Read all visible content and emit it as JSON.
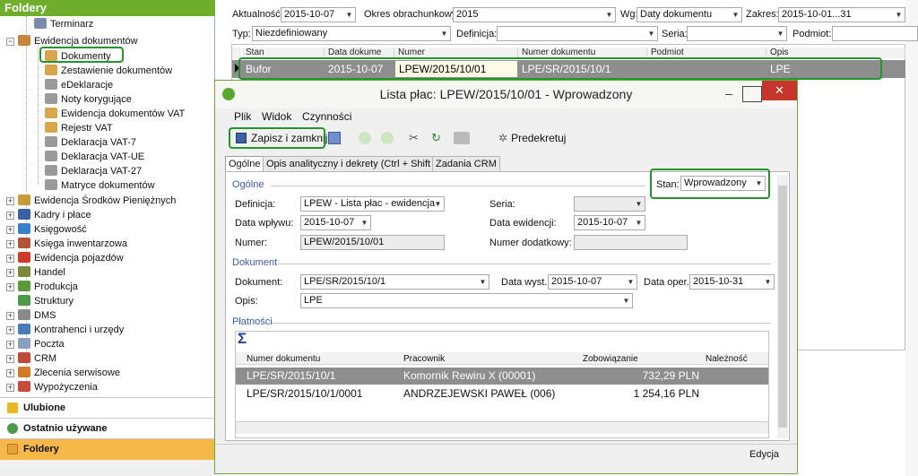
{
  "left_panel": {
    "title": "Foldery",
    "items": [
      {
        "label": "Terminarz",
        "color": "#7a8ca8"
      },
      {
        "label": "Ewidencja dokumentów",
        "color": "#c8843a"
      },
      {
        "label": "Dokumenty",
        "color": "#d9a650"
      },
      {
        "label": "Zestawienie dokumentów",
        "color": "#d9a650"
      },
      {
        "label": "eDeklaracje",
        "color": "#9a9a9a"
      },
      {
        "label": "Noty korygujące",
        "color": "#9a9a9a"
      },
      {
        "label": "Ewidencja dokumentów VAT",
        "color": "#d9a650"
      },
      {
        "label": "Rejestr VAT",
        "color": "#d9a650"
      },
      {
        "label": "Deklaracja VAT-7",
        "color": "#9a9a9a"
      },
      {
        "label": "Deklaracja VAT-UE",
        "color": "#9a9a9a"
      },
      {
        "label": "Deklaracja VAT-27",
        "color": "#9a9a9a"
      },
      {
        "label": "Matryce dokumentów",
        "color": "#9a9a9a"
      },
      {
        "label": "Ewidencja Środków Pieniężnych",
        "color": "#c99a3a"
      },
      {
        "label": "Kadry i płace",
        "color": "#3a5fa8"
      },
      {
        "label": "Księgowość",
        "color": "#3a80c8"
      },
      {
        "label": "Księga inwentarzowa",
        "color": "#b0543a"
      },
      {
        "label": "Ewidencja pojazdów",
        "color": "#d03a2a"
      },
      {
        "label": "Handel",
        "color": "#7a8a3a"
      },
      {
        "label": "Produkcja",
        "color": "#5a9a3a"
      },
      {
        "label": "Struktury",
        "color": "#4a9a4a"
      },
      {
        "label": "DMS",
        "color": "#8a8a8a"
      },
      {
        "label": "Kontrahenci i urzędy",
        "color": "#4a7ab8"
      },
      {
        "label": "Poczta",
        "color": "#8aa0c0"
      },
      {
        "label": "CRM",
        "color": "#c04a3a"
      },
      {
        "label": "Zlecenia serwisowe",
        "color": "#d07a2a"
      },
      {
        "label": "Wypożyczenia",
        "color": "#c84a3a"
      }
    ],
    "bottom": [
      {
        "label": "Ulubione",
        "color": "#e8b820"
      },
      {
        "label": "Ostatnio używane",
        "color": "#4a9a4a"
      },
      {
        "label": "Foldery",
        "color": "#d9a650"
      }
    ]
  },
  "filters": {
    "aktualnosc_label": "Aktualność:",
    "aktualnosc_value": "2015-10-07",
    "okres_label": "Okres obrachunkowy:",
    "okres_value": "2015",
    "wg_label": "Wg:",
    "wg_value": "Daty dokumentu",
    "zakres_label": "Zakres:",
    "zakres_value": "2015-10-01...31",
    "typ_label": "Typ:",
    "typ_value": "Niezdefiniowany",
    "definicja_label": "Definicja:",
    "definicja_value": "",
    "seria_label": "Seria:",
    "seria_value": "",
    "podmiot_label": "Podmiot:",
    "podmiot_value": ""
  },
  "grid": {
    "headers": [
      "Stan",
      "Data dokume",
      "Numer",
      "Numer dokumentu",
      "Podmiot",
      "Opis"
    ],
    "row": {
      "stan": "Bufor",
      "data": "2015-10-07",
      "numer": "LPEW/2015/10/01",
      "numer_dok": "LPE/SR/2015/10/1",
      "podmiot": "",
      "opis": "LPE"
    }
  },
  "dialog": {
    "title": "Lista płac: LPEW/2015/10/01 - Wprowadzony",
    "menu": [
      "Plik",
      "Widok",
      "Czynności"
    ],
    "toolbar": {
      "save_close": "Zapisz i zamknij",
      "predekretuj": "Predekretuj"
    },
    "tabs": [
      "Ogólne",
      "Opis analityczny i dekrety (Ctrl + Shift + D)",
      "Zadania CRM"
    ],
    "stan_label": "Stan:",
    "stan_value": "Wprowadzony",
    "ogolne": {
      "section": "Ogólne",
      "definicja_label": "Definicja:",
      "definicja_value": "LPEW - Lista płac - ewidencja",
      "seria_label": "Seria:",
      "seria_value": "",
      "data_wplywu_label": "Data wpływu:",
      "data_wplywu_value": "2015-10-07",
      "data_ewidencji_label": "Data ewidencji:",
      "data_ewidencji_value": "2015-10-07",
      "numer_label": "Numer:",
      "numer_value": "LPEW/2015/10/01",
      "numer_dod_label": "Numer dodatkowy:",
      "numer_dod_value": ""
    },
    "dokument": {
      "section": "Dokument",
      "dokument_label": "Dokument:",
      "dokument_value": "LPE/SR/2015/10/1",
      "data_wyst_label": "Data wyst.:",
      "data_wyst_value": "2015-10-07",
      "data_oper_label": "Data oper.:",
      "data_oper_value": "2015-10-31",
      "opis_label": "Opis:",
      "opis_value": "LPE"
    },
    "platnosci": {
      "section": "Płatności",
      "sigma": "Σ",
      "headers": [
        "Numer dokumentu",
        "Pracownik",
        "Zobowiązanie",
        "Należność"
      ],
      "rows": [
        {
          "numer": "LPE/SR/2015/10/1",
          "pracownik": "Komornik Rewiru X (00001)",
          "zobowiazanie": "732,29 PLN",
          "naleznosc": ""
        },
        {
          "numer": "LPE/SR/2015/10/1/0001",
          "pracownik": "ANDRZEJEWSKI PAWEŁ (006)",
          "zobowiazanie": "1 254,16 PLN",
          "naleznosc": ""
        }
      ]
    },
    "status": "Edycja"
  },
  "colors": {
    "accent_green": "#22962a",
    "title_green": "#6fae2c",
    "selected_row": "#8e8e8e"
  }
}
